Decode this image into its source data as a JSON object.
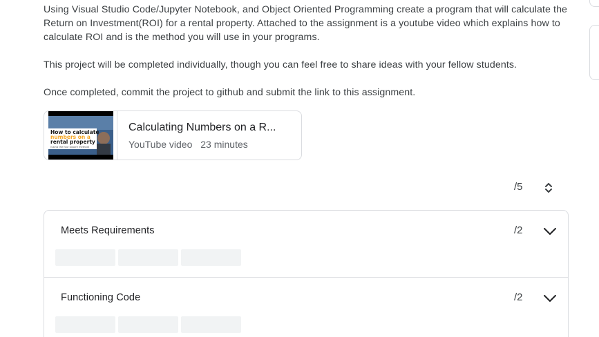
{
  "instructions": {
    "paragraph_1": "Using Visual Studio Code/Jupyter Notebook, and Object Oriented Programming create a program that will calculate the Return on Investment(ROI) for a rental property. Attached to the assignment is a youtube video which explains how to calculate ROI and is the method you will use in your programs.",
    "paragraph_2": "This project will be completed individually, though you can feel free to share ideas with your fellow students.",
    "paragraph_3": "Once completed, commit the project to github and submit the link to this assignment."
  },
  "attachment": {
    "title": "Calculating Numbers on a R...",
    "source": "YouTube video",
    "duration": "23 minutes",
    "thumbnail": {
      "line_1": "How to calculate",
      "line_2": "numbers on a",
      "line_3": "rental property",
      "line_4": "(using the four square method)",
      "icon": "youtube-thumbnail"
    }
  },
  "rubric": {
    "total_points": "/5",
    "criteria": [
      {
        "title": "Meets Requirements",
        "points": "/2",
        "levels": 3
      },
      {
        "title": "Functioning Code",
        "points": "/2",
        "levels": 3
      }
    ]
  },
  "colors": {
    "border": "#dadce0",
    "placeholder": "#f1f3f4",
    "text_primary": "#202124",
    "text_secondary": "#5f6368",
    "thumbnail_blue": "#3b5f8a",
    "thumbnail_highlight": "#f5a623"
  }
}
